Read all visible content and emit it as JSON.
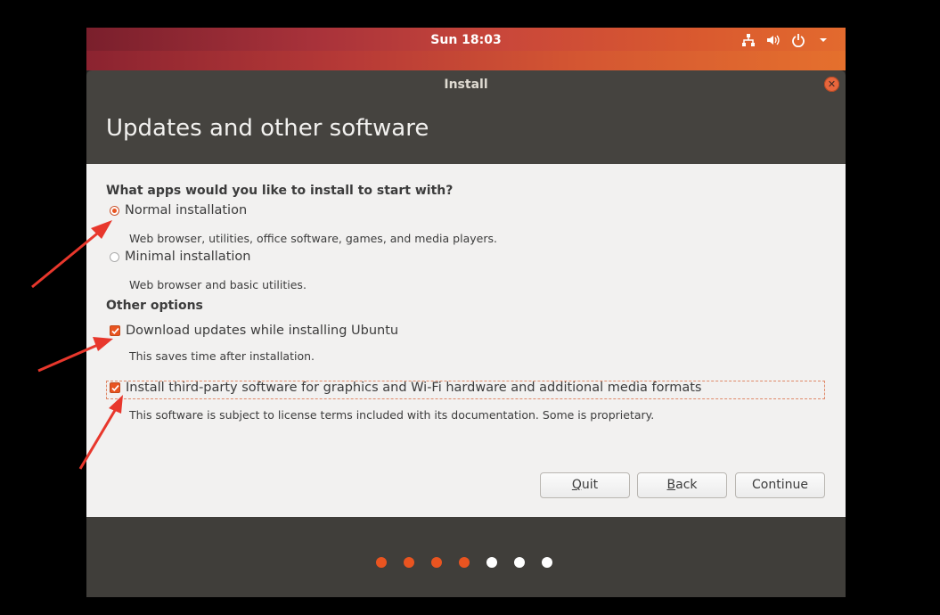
{
  "topbar": {
    "clock": "Sun 18:03",
    "tray_icons": [
      "network-icon",
      "volume-icon",
      "power-icon",
      "chevron-down-icon"
    ]
  },
  "window": {
    "title": "Install",
    "header_title": "Updates and other software"
  },
  "apps": {
    "question": "What apps would you like to install to start with?",
    "options": [
      {
        "label": "Normal installation",
        "description": "Web browser, utilities, office software, games, and media players.",
        "selected": true
      },
      {
        "label": "Minimal installation",
        "description": "Web browser and basic utilities.",
        "selected": false
      }
    ]
  },
  "other": {
    "heading": "Other options",
    "items": [
      {
        "label": "Download updates while installing Ubuntu",
        "description": "This saves time after installation.",
        "checked": true
      },
      {
        "label": "Install third-party software for graphics and Wi-Fi hardware and additional media formats",
        "description": "This software is subject to license terms included with its documentation. Some is proprietary.",
        "checked": true
      }
    ]
  },
  "buttons": {
    "quit_accel": "Q",
    "quit_rest": "uit",
    "back_accel": "B",
    "back_rest": "ack",
    "continue": "Continue"
  },
  "progress": {
    "total_steps": 7,
    "completed_steps": 4,
    "active_color": "#e95420",
    "inactive_color": "#ffffff"
  },
  "colors": {
    "accent": "#e95420",
    "annotation_arrow": "#e8372c"
  }
}
